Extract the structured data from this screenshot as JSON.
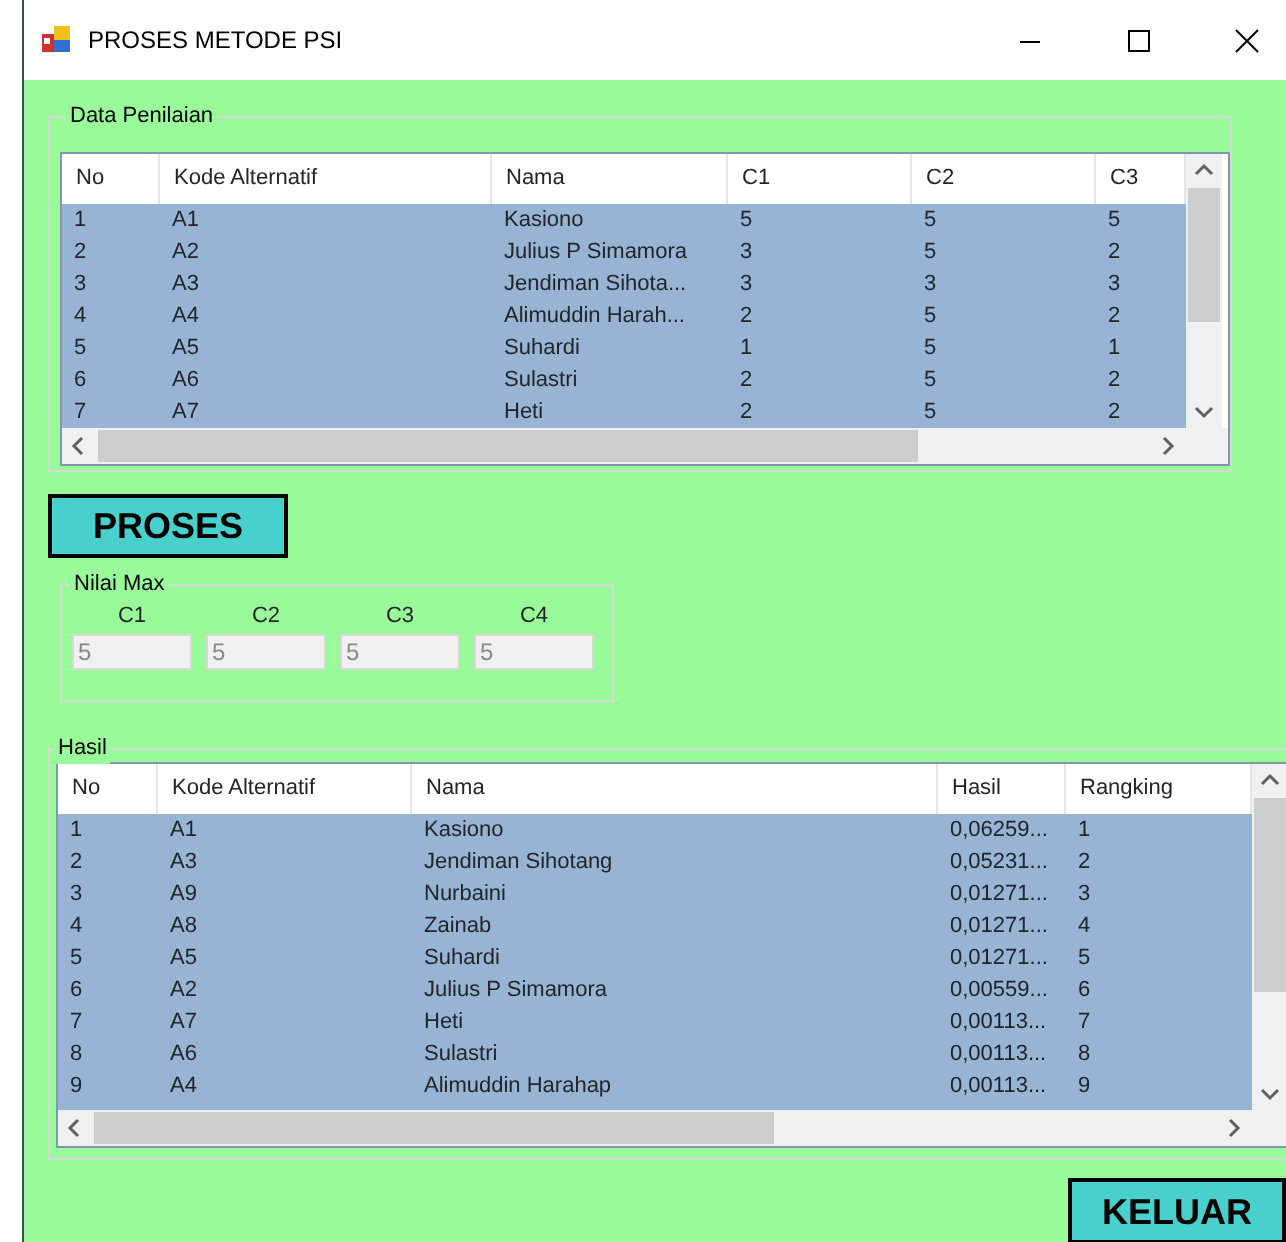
{
  "window": {
    "title": "PROSES METODE PSI"
  },
  "data_penilaian": {
    "title": "Data Penilaian",
    "columns": [
      "No",
      "Kode Alternatif",
      "Nama",
      "C1",
      "C2",
      "C3"
    ],
    "rows": [
      {
        "cells": [
          "1",
          "A1",
          "Kasiono",
          "5",
          "5",
          "5"
        ],
        "selected": true
      },
      {
        "cells": [
          "2",
          "A2",
          "Julius P Simamora",
          "3",
          "5",
          "2"
        ],
        "selected": true
      },
      {
        "cells": [
          "3",
          "A3",
          "Jendiman Sihota...",
          "3",
          "3",
          "3"
        ],
        "selected": true
      },
      {
        "cells": [
          "4",
          "A4",
          "Alimuddin Harah...",
          "2",
          "5",
          "2"
        ],
        "selected": true
      },
      {
        "cells": [
          "5",
          "A5",
          "Suhardi",
          "1",
          "5",
          "1"
        ],
        "selected": true
      },
      {
        "cells": [
          "6",
          "A6",
          "Sulastri",
          "2",
          "5",
          "2"
        ],
        "selected": true
      },
      {
        "cells": [
          "7",
          "A7",
          "Heti",
          "2",
          "5",
          "2"
        ],
        "selected": true
      }
    ]
  },
  "proses_button": "PROSES",
  "nilai_max": {
    "title": "Nilai Max",
    "fields": [
      {
        "label": "C1",
        "value": "5",
        "disabled": true
      },
      {
        "label": "C2",
        "value": "5",
        "disabled": true
      },
      {
        "label": "C3",
        "value": "5",
        "disabled": true
      },
      {
        "label": "C4",
        "value": "5",
        "disabled": true
      }
    ]
  },
  "hasil": {
    "title": "Hasil",
    "columns": [
      "No",
      "Kode Alternatif",
      "Nama",
      "Hasil",
      "Rangking"
    ],
    "rows": [
      {
        "cells": [
          "1",
          "A1",
          "Kasiono",
          "0,06259...",
          "1"
        ],
        "selected": true
      },
      {
        "cells": [
          "2",
          "A3",
          "Jendiman Sihotang",
          "0,05231...",
          "2"
        ],
        "selected": true
      },
      {
        "cells": [
          "3",
          "A9",
          "Nurbaini",
          "0,01271...",
          "3"
        ],
        "selected": true
      },
      {
        "cells": [
          "4",
          "A8",
          "Zainab",
          "0,01271...",
          "4"
        ],
        "selected": true
      },
      {
        "cells": [
          "5",
          "A5",
          "Suhardi",
          "0,01271...",
          "5"
        ],
        "selected": true
      },
      {
        "cells": [
          "6",
          "A2",
          "Julius P Simamora",
          "0,00559...",
          "6"
        ],
        "selected": true
      },
      {
        "cells": [
          "7",
          "A7",
          "Heti",
          "0,00113...",
          "7"
        ],
        "selected": true
      },
      {
        "cells": [
          "8",
          "A6",
          "Sulastri",
          "0,00113...",
          "8"
        ],
        "selected": true
      },
      {
        "cells": [
          "9",
          "A4",
          "Alimuddin Harahap",
          "0,00113...",
          "9"
        ],
        "selected": true
      }
    ]
  },
  "keluar_button": "KELUAR"
}
